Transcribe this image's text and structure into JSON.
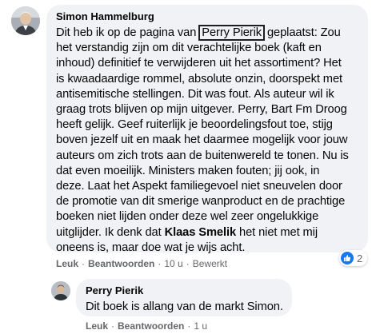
{
  "main_comment": {
    "author": "Simon Hammelburg",
    "lines": [
      {
        "before": "Dit heb ik op de pagina van ",
        "mention": "Perry Pierik",
        "after": " geplaatst: Zou"
      },
      {
        "text": "het verstandig zijn om dit verachtelijke boek (kaft en"
      },
      {
        "text": "inhoud) definitief te verwijderen uit het assortiment? Het"
      },
      {
        "text": "is kwaadaardige rommel, absolute onzin, doorspekt met"
      },
      {
        "text": "antisemitische stellingen. Dit was fout. Als auteur wil ik"
      },
      {
        "text": "graag trots blijven op mijn uitgever. Perry, Bart Fm Droog"
      },
      {
        "text": "heeft gelijk. Geef ruiterlijk je beoordelingsfout toe, stijg"
      },
      {
        "text": "boven jezelf uit en maak het daarmee mogelijk voor jouw"
      },
      {
        "text": "auteurs om zich trots aan de buitenwereld te tonen. Nu is"
      },
      {
        "text": "dat even moeilijk. Ministers maken fouten; jij ook, in"
      },
      {
        "text": "deze. Laat het Aspekt familiegevoel niet sneuvelen door"
      },
      {
        "text": "de promotie van dit smerige wanproduct en de prachtige"
      },
      {
        "text": "boeken niet lijden onder deze wel zeer ongelukkige"
      },
      {
        "before": "uitglijder. Ik denk dat ",
        "mention": "Klaas Smelik",
        "after": " het niet met mij"
      },
      {
        "text": "oneens is, maar doe wat je wijs acht."
      }
    ],
    "actions": {
      "like": "Leuk",
      "reply": "Beantwoorden",
      "time": "10 u",
      "edited": "Bewerkt"
    },
    "reaction_count": "2",
    "reaction_icon": "like-icon",
    "accent_color": "#1877f2"
  },
  "reply": {
    "author": "Perry Pierik",
    "text": "Dit boek is allang van de markt Simon.",
    "actions": {
      "like": "Leuk",
      "reply": "Beantwoorden",
      "time": "1 u"
    }
  },
  "separator": "·"
}
